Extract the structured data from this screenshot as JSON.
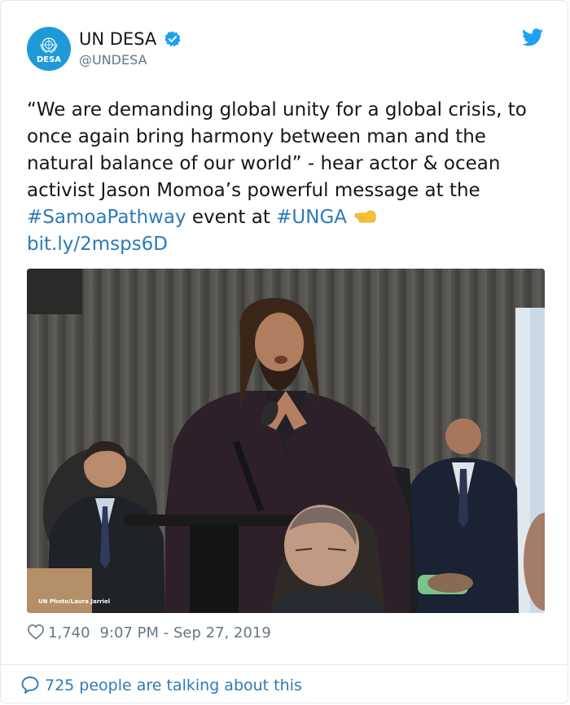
{
  "account": {
    "avatar_text": "DESA",
    "display_name": "UN DESA",
    "handle": "@UNDESA",
    "verified": true
  },
  "icons": {
    "verified": "verified-badge-icon",
    "platform": "twitter-bird-icon",
    "emoji": "backhand-index-pointing-left-emoji",
    "like": "heart-icon",
    "reply": "speech-bubble-icon"
  },
  "tweet": {
    "text_main": "“We are demanding global unity for a global crisis, to once again bring harmony between man and the natural balance of our world” - hear actor & ocean activist Jason Momoa’s powerful message at the ",
    "hashtag_1": "#SamoaPathway",
    "text_mid": " event at ",
    "hashtag_2": "#UNGA",
    "link": "bit.ly/2msps6D"
  },
  "photo": {
    "credit": "UN Photo/Laura Jarriel"
  },
  "meta": {
    "likes": "1,740",
    "timestamp": "9:07 PM - Sep 27, 2019"
  },
  "footer": {
    "talking": "725 people are talking about this"
  },
  "colors": {
    "link": "#2b7bb9",
    "avatar_bg": "#1f9ad6",
    "verified": "#1da1f2",
    "muted": "#657786"
  }
}
